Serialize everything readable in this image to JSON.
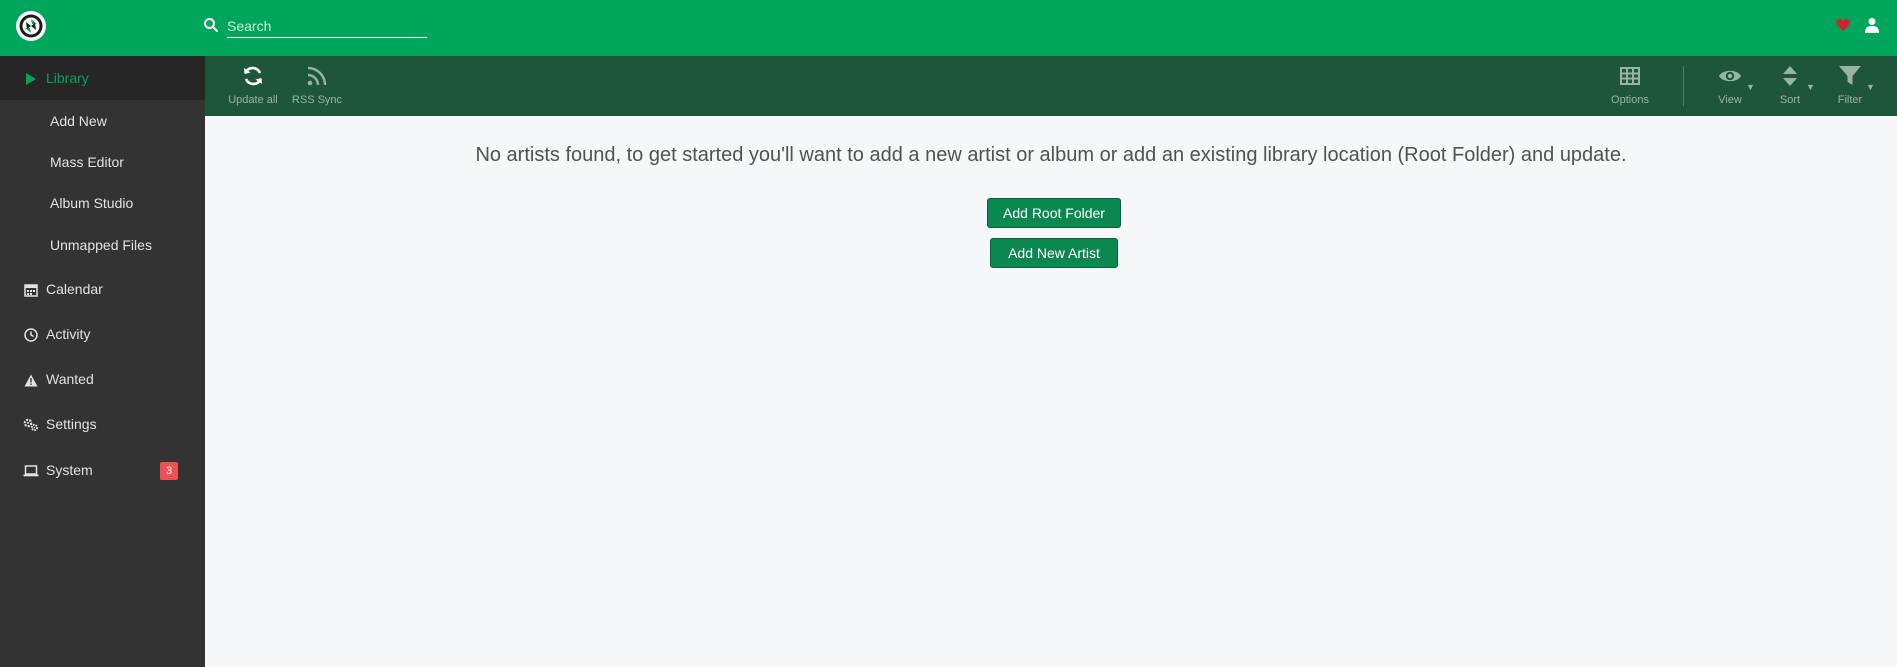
{
  "header": {
    "search_placeholder": "Search"
  },
  "sidebar": {
    "items": [
      {
        "label": "Library",
        "icon": "play-icon",
        "active": true
      },
      {
        "label": "Add New",
        "sub": true
      },
      {
        "label": "Mass Editor",
        "sub": true
      },
      {
        "label": "Album Studio",
        "sub": true
      },
      {
        "label": "Unmapped Files",
        "sub": true
      },
      {
        "label": "Calendar",
        "icon": "calendar-icon"
      },
      {
        "label": "Activity",
        "icon": "clock-icon"
      },
      {
        "label": "Wanted",
        "icon": "warning-icon"
      },
      {
        "label": "Settings",
        "icon": "cogs-icon"
      },
      {
        "label": "System",
        "icon": "laptop-icon",
        "badge": "3"
      }
    ]
  },
  "toolbar": {
    "update_all": "Update all",
    "rss_sync": "RSS Sync",
    "options": "Options",
    "view": "View",
    "sort": "Sort",
    "filter": "Filter"
  },
  "main": {
    "empty_message": "No artists found, to get started you'll want to add a new artist or album or add an existing library location (Root Folder) and update.",
    "add_root_folder": "Add Root Folder",
    "add_new_artist": "Add New Artist"
  },
  "colors": {
    "header": "#00a65b",
    "sidebar": "#333333",
    "toolbar": "#1d563b",
    "accent": "#00a65b",
    "button": "#0b8750",
    "badge": "#f05050",
    "heart": "#d2232a"
  }
}
